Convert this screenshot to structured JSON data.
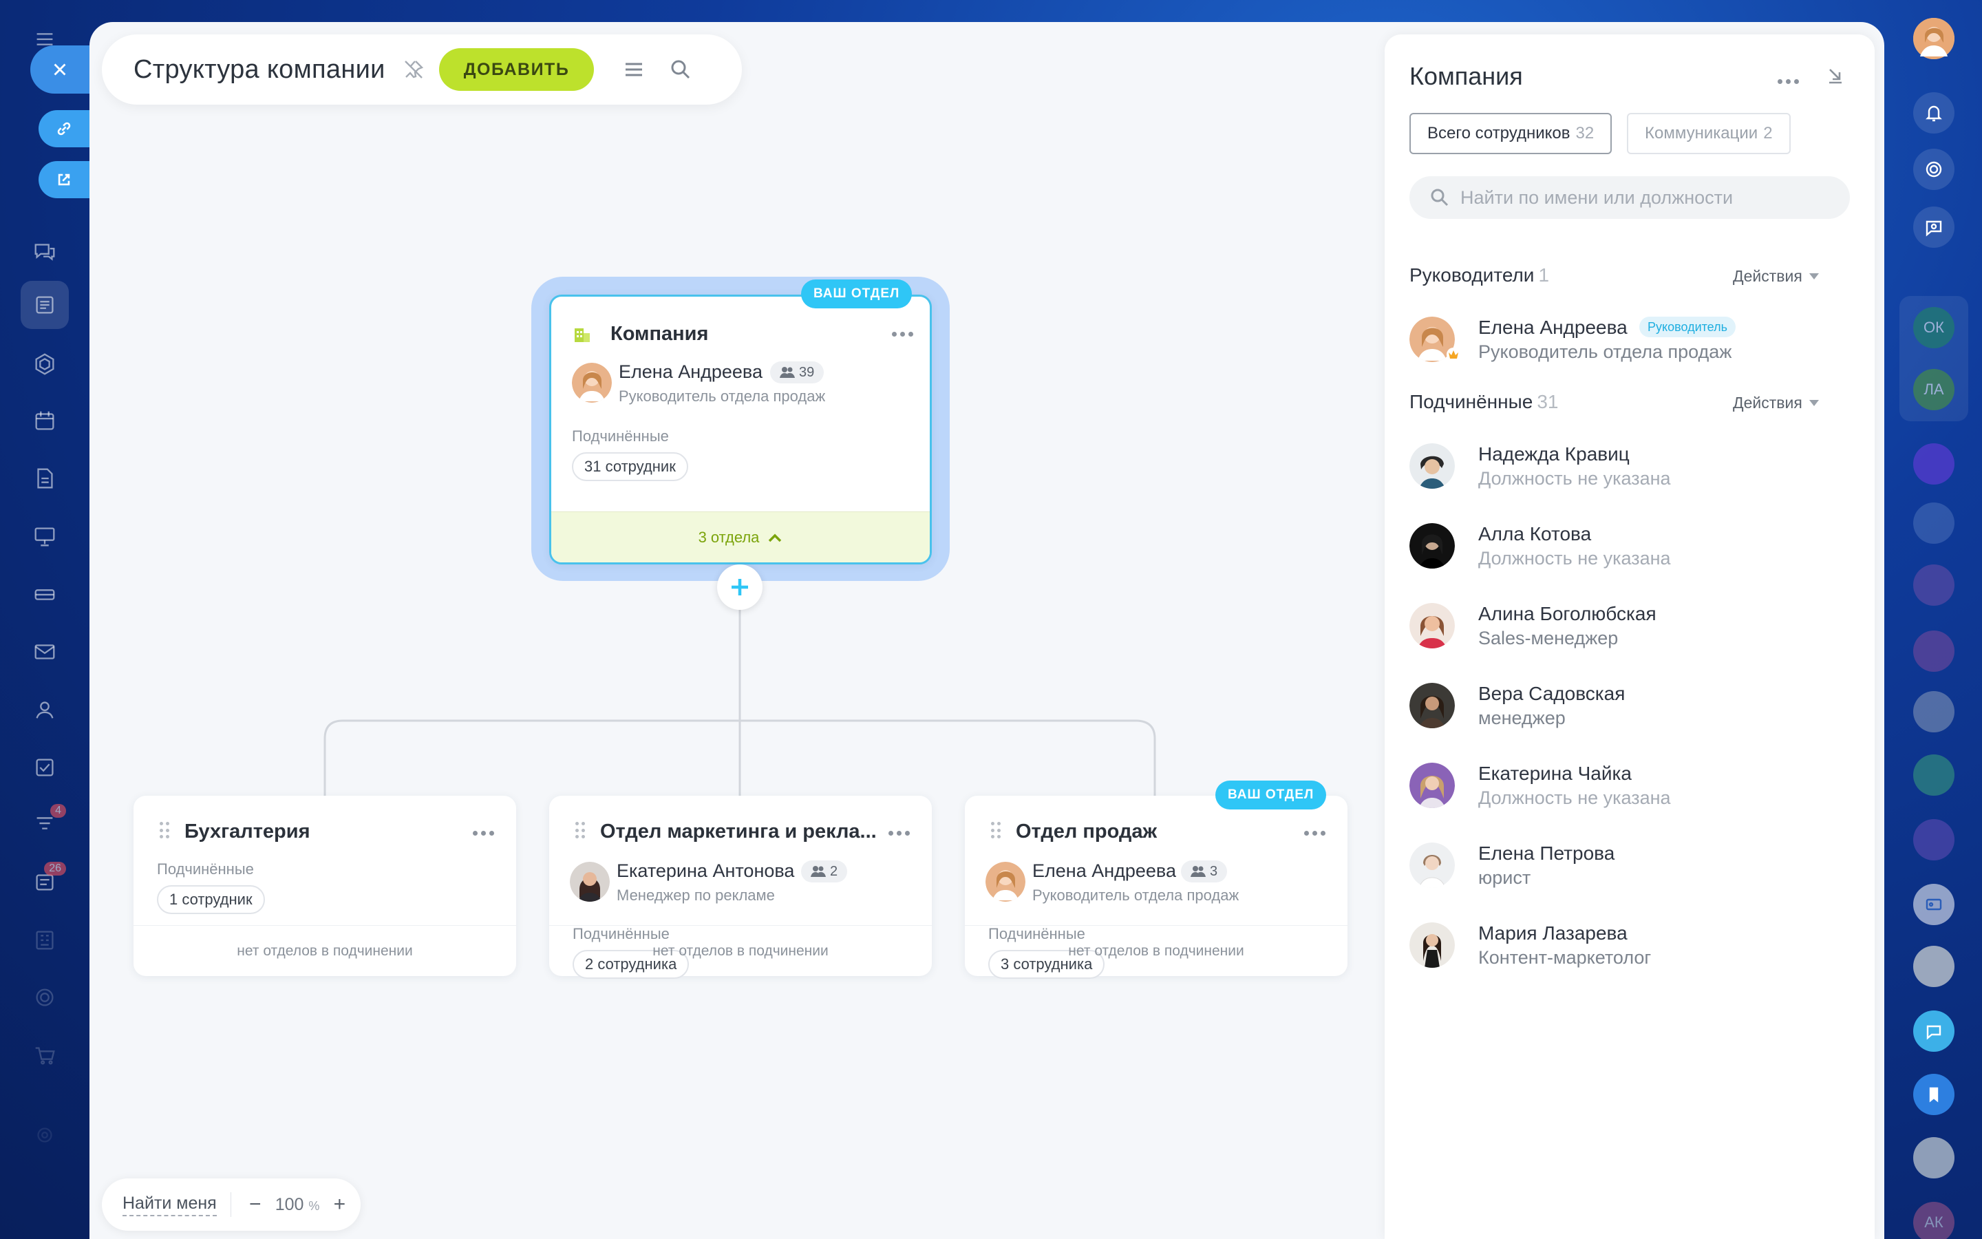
{
  "toolbar": {
    "title": "Структура компании",
    "add_label": "ДОБАВИТЬ"
  },
  "root_card": {
    "title": "Компания",
    "your_dept_badge": "ВАШ ОТДЕЛ",
    "head_name": "Елена Андреева",
    "head_count": "39",
    "head_role": "Руководитель отдела продаж",
    "sub_label": "Подчинённые",
    "employees": "31 сотрудник",
    "footer": "3 отдела"
  },
  "departments": [
    {
      "title": "Бухгалтерия",
      "sub_label": "Подчинённые",
      "employees": "1 сотрудник",
      "footer": "нет отделов в подчинении"
    },
    {
      "title": "Отдел маркетинга и рекла...",
      "head_name": "Екатерина Антонова",
      "head_count": "2",
      "head_role": "Менеджер по рекламе",
      "sub_label": "Подчинённые",
      "employees": "2 сотрудника",
      "footer": "нет отделов в подчинении"
    },
    {
      "title": "Отдел продаж",
      "your_dept_badge": "ВАШ ОТДЕЛ",
      "head_name": "Елена Андреева",
      "head_count": "3",
      "head_role": "Руководитель отдела продаж",
      "sub_label": "Подчинённые",
      "employees": "3 сотрудника",
      "footer": "нет отделов в подчинении"
    }
  ],
  "zoom": {
    "find_me": "Найти меня",
    "minus": "−",
    "value": "100",
    "unit": "%",
    "plus": "+"
  },
  "panel": {
    "title": "Компания",
    "tabs": [
      {
        "label": "Всего сотрудников",
        "count": "32"
      },
      {
        "label": "Коммуникации",
        "count": "2"
      }
    ],
    "search_placeholder": "Найти по имени или должности",
    "leaders": {
      "label": "Руководители",
      "count": "1",
      "actions": "Действия"
    },
    "leader": {
      "name": "Елена Андреева",
      "tag": "Руководитель",
      "role": "Руководитель отдела продаж"
    },
    "subordinates": {
      "label": "Подчинённые",
      "count": "31",
      "actions": "Действия"
    },
    "members": [
      {
        "name": "Надежда Кравиц",
        "role": "Должность не указана"
      },
      {
        "name": "Алла Котова",
        "role": "Должность не указана"
      },
      {
        "name": "Алина Боголюбская",
        "role": "Sales-менеджер"
      },
      {
        "name": "Вера Садовская",
        "role": "менеджер"
      },
      {
        "name": "Екатерина Чайка",
        "role": "Должность не указана"
      },
      {
        "name": "Елена Петрова",
        "role": "юрист"
      },
      {
        "name": "Мария Лазарева",
        "role": "Контент-маркетолог"
      }
    ]
  },
  "right_dock": {
    "ok_initials": "ОК",
    "la_initials": "ЛА",
    "ak_initials": "АК"
  },
  "left_dock": {
    "badge_1": "4",
    "badge_2": "26"
  },
  "colors": {
    "accent_green": "#bde12c",
    "accent_blue": "#2fc6f6",
    "root_glow": "#bcd6fa"
  }
}
